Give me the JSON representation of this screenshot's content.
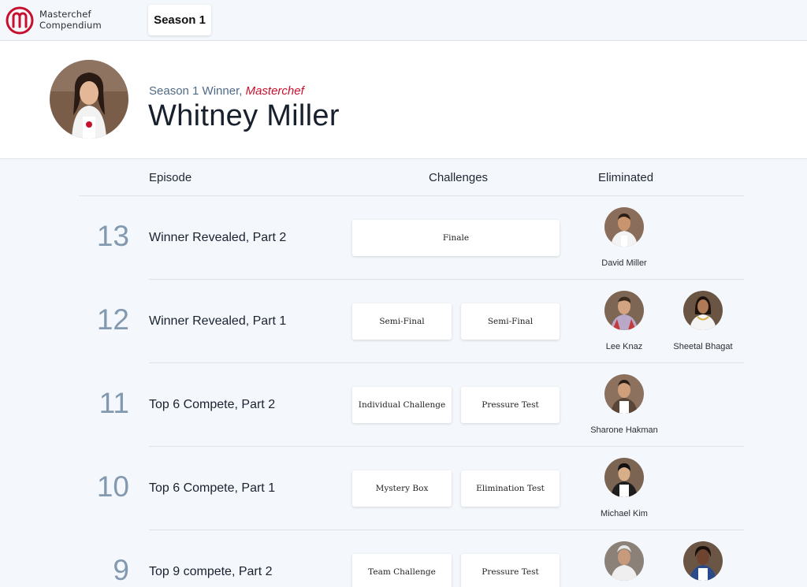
{
  "header": {
    "brand_line1": "Masterchef",
    "brand_line2": "Compendium",
    "season_tab": "Season 1",
    "logo_icon": "masterchef-logo-icon",
    "accent": "#c8102e"
  },
  "winner": {
    "subtitle_prefix": "Season 1 Winner, ",
    "subtitle_show": "Masterchef",
    "name": "Whitney Miller"
  },
  "table": {
    "col_episode": "Episode",
    "col_challenges": "Challenges",
    "col_eliminated": "Eliminated"
  },
  "episodes": [
    {
      "number": "13",
      "title": "Winner Revealed, Part 2",
      "challenges": [
        "Finale"
      ],
      "eliminated": [
        "David Miller"
      ]
    },
    {
      "number": "12",
      "title": "Winner Revealed, Part 1",
      "challenges": [
        "Semi-Final",
        "Semi-Final"
      ],
      "eliminated": [
        "Lee Knaz",
        "Sheetal Bhagat"
      ]
    },
    {
      "number": "11",
      "title": "Top 6 Compete, Part 2",
      "challenges": [
        "Individual Challenge",
        "Pressure Test"
      ],
      "eliminated": [
        "Sharone Hakman"
      ]
    },
    {
      "number": "10",
      "title": "Top 6 Compete, Part 1",
      "challenges": [
        "Mystery Box",
        "Elimination Test"
      ],
      "eliminated": [
        "Michael Kim"
      ]
    },
    {
      "number": "9",
      "title": "Top 9 compete, Part 2",
      "challenges": [
        "Team Challenge",
        "Pressure Test"
      ],
      "eliminated": [
        "",
        ""
      ]
    }
  ]
}
